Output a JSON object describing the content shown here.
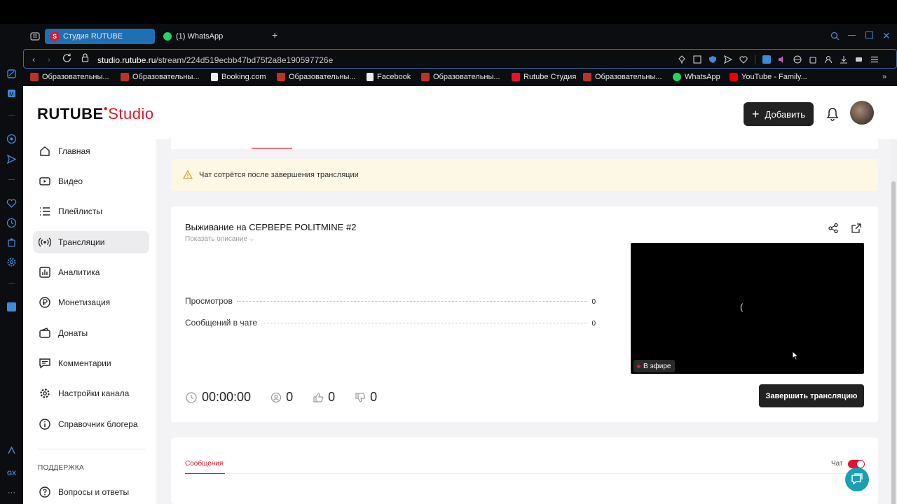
{
  "browser": {
    "tabs": [
      {
        "label": "Студия RUTUBE",
        "active": true
      },
      {
        "label": "(1) WhatsApp",
        "active": false
      }
    ],
    "url_host": "studio.rutube.ru",
    "url_path": "/stream/224d519ecbb47bd75f2a8e190597726e",
    "bookmarks": [
      "Образовательны...",
      "Образовательны...",
      "Booking.com",
      "Образовательны...",
      "Facebook",
      "Образовательны...",
      "Rutube Студия",
      "Образовательны...",
      "WhatsApp",
      "YouTube - Family..."
    ]
  },
  "header": {
    "logo_main": "RUTUBE",
    "logo_studio": "Studio",
    "add_label": "Добавить"
  },
  "sidebar": {
    "items": [
      {
        "label": "Главная",
        "icon": "home-icon"
      },
      {
        "label": "Видео",
        "icon": "video-icon"
      },
      {
        "label": "Плейлисты",
        "icon": "playlist-icon"
      },
      {
        "label": "Трансляции",
        "icon": "broadcast-icon",
        "active": true
      },
      {
        "label": "Аналитика",
        "icon": "analytics-icon"
      },
      {
        "label": "Монетизация",
        "icon": "ruble-icon"
      },
      {
        "label": "Донаты",
        "icon": "wallet-icon"
      },
      {
        "label": "Комментарии",
        "icon": "comment-icon"
      },
      {
        "label": "Настройки канала",
        "icon": "gear-icon"
      },
      {
        "label": "Справочник блогера",
        "icon": "info-icon"
      }
    ],
    "support_title": "ПОДДЕРЖКА",
    "support_items": [
      {
        "label": "Вопросы и ответы",
        "icon": "question-icon"
      }
    ]
  },
  "alert": {
    "text": "Чат сотрётся после завершения трансляции"
  },
  "stream": {
    "title": "Выживание на СЕРВЕРЕ POLITMINE #2",
    "show_description": "Показать описание",
    "stats": [
      {
        "label": "Просмотров",
        "value": "0"
      },
      {
        "label": "Сообщений в чате",
        "value": "0"
      }
    ],
    "live_badge": "В эфире",
    "spinner_glyph": "(",
    "timer": "00:00:00",
    "viewers": "0",
    "likes": "0",
    "dislikes": "0",
    "end_button": "Завершить трансляцию"
  },
  "chat": {
    "tab_messages": "Сообщения",
    "chat_label": "Чат",
    "chat_enabled": true
  },
  "colors": {
    "accent_red": "#e5122d",
    "dark_button": "#222222",
    "help_fab": "#1a9fb3"
  }
}
